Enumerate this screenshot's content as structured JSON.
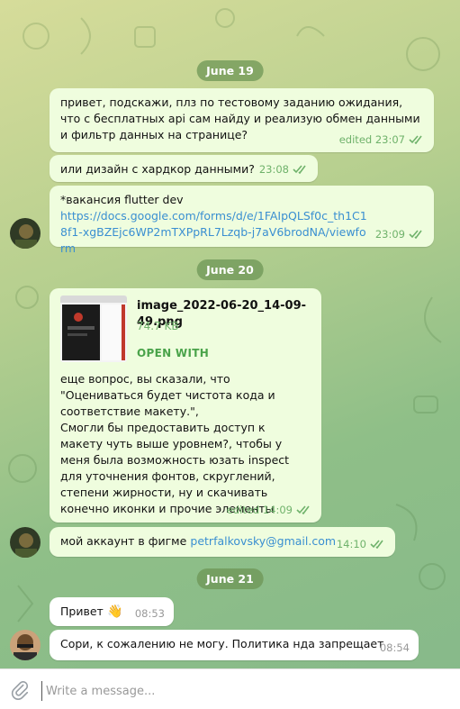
{
  "chat": {
    "dates": {
      "d1": "June 19",
      "d2": "June 20",
      "d3": "June 21"
    },
    "messages": {
      "m1": {
        "text": "привет, подскажи, плз по тестовому заданию ожидания, что с бесплатных api сам найду и реализую обмен данными и фильтр данных на странице?",
        "time": "edited 23:07"
      },
      "m2": {
        "text": "или дизайн с хардкор данными?",
        "time": "23:08"
      },
      "m3": {
        "text": "*вакансия flutter dev",
        "link": "https://docs.google.com/forms/d/e/1FAIpQLSf0c_th1C18f1-xgBZEjc6WP2mTXPpRL7Lzqb-j7aV6brodNA/viewform",
        "time": "23:09"
      },
      "m4": {
        "file_name": "image_2022-06-20_14-09-49.png",
        "file_size": "74.7 KB",
        "open_with": "OPEN WITH",
        "text": "еще вопрос, вы сказали, что \"Оцениваться будет чистота кода и соответствие макету.\",\nСмогли бы предоставить доступ к макету чуть выше уровнем?, чтобы у меня была возможность юзать inspect для уточнения фонтов, скруглений, степени жирности, ну и скачивать конечно иконки и прочие элементы",
        "time": "edited 14:09"
      },
      "m5": {
        "text": "мой аккаунт в фигме",
        "link": "petrfalkovsky@gmail.com",
        "time": "14:10"
      },
      "m6": {
        "text": "Привет",
        "emoji": "👋",
        "time": "08:53"
      },
      "m7": {
        "text": "Сори, к сожалению не могу. Политика нда запрещает",
        "time": "08:54"
      }
    }
  },
  "composer": {
    "placeholder": "Write a message..."
  },
  "colors": {
    "bubble": "#effdde",
    "meta_green": "#6fb26b",
    "link_blue": "#3a8fd1",
    "date_pill": "#6e9655"
  }
}
